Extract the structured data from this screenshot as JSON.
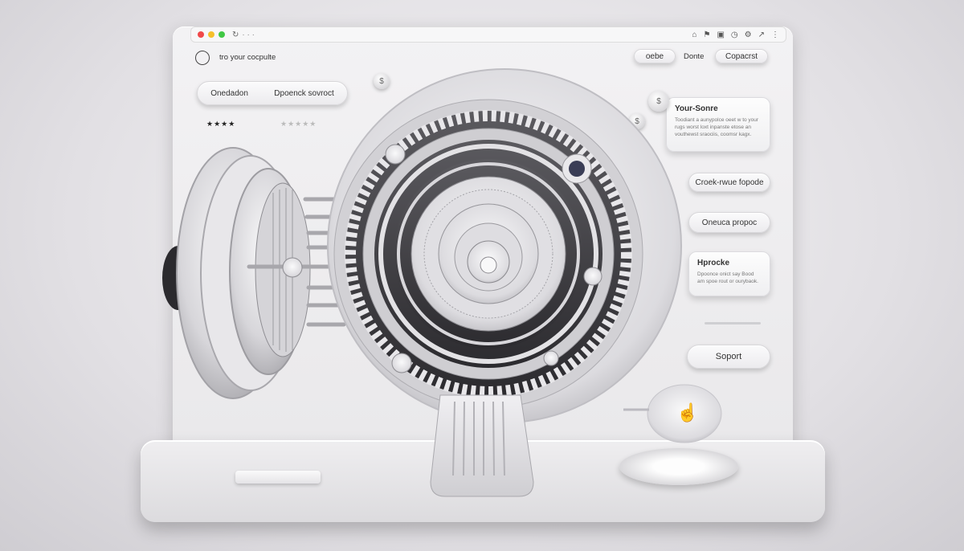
{
  "titlebar": {
    "url_text": "· · ·"
  },
  "header": {
    "title": "tro your cocpulte",
    "buttons": [
      "oebe",
      "Donte",
      "Copacrst"
    ]
  },
  "toolbar_pill": {
    "left": "Onedadon",
    "right": "Dpoenck sovroct"
  },
  "ratings": {
    "left": "★★★★",
    "right": "★★★★★"
  },
  "info_card": {
    "title": "Your-Sonre",
    "body": "Toodiant a aunypolce oeet w to your rugs worst loxt inpanste etose an vouthewst sraociis, coomsr kagx."
  },
  "side_pills": [
    "Croek-rwue fopode",
    "Oneuca propoc"
  ],
  "process_card": {
    "title": "Hprocke",
    "body": "Dpoonce onict say Bood am spoe rout or ourybaok."
  },
  "support_button": "Soport",
  "coin_symbol": "$",
  "cursor_icon": "hand-pointer-icon",
  "colors": {
    "red": "#f0494a",
    "yellow": "#f5c02b",
    "green": "#41c845"
  }
}
